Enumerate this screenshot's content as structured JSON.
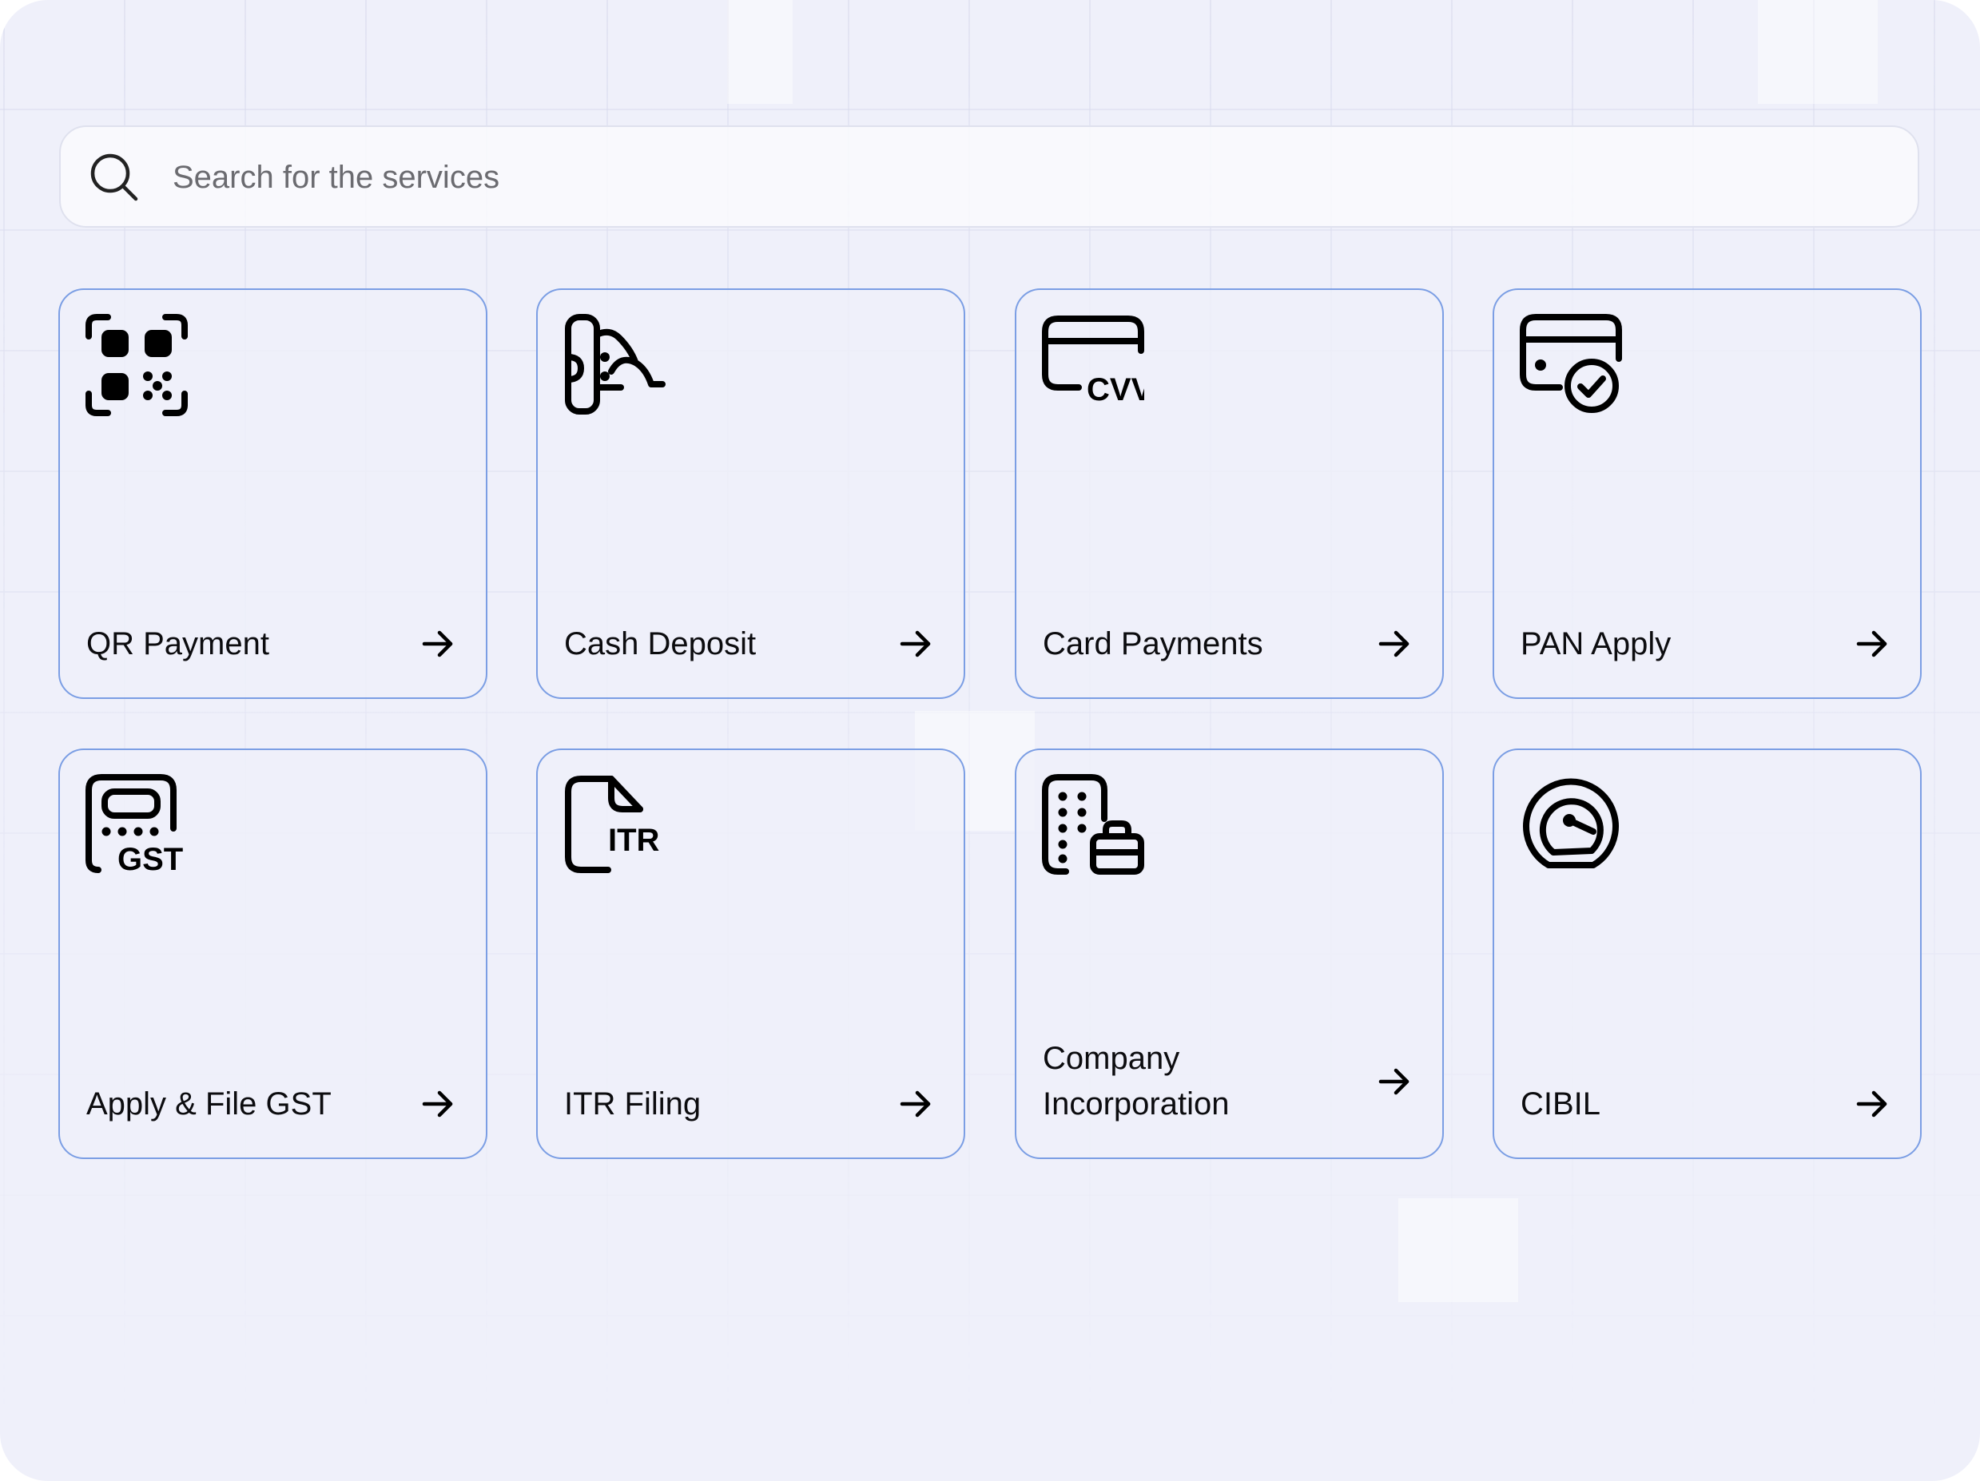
{
  "search": {
    "placeholder": "Search for the services",
    "value": ""
  },
  "services": [
    {
      "label": "QR Payment",
      "icon": "qr-code-icon"
    },
    {
      "label": "Cash Deposit",
      "icon": "cash-deposit-icon"
    },
    {
      "label": "Card Payments",
      "icon": "card-cvv-icon"
    },
    {
      "label": "PAN Apply",
      "icon": "pan-card-check-icon"
    },
    {
      "label": "Apply & File GST",
      "icon": "gst-receipt-icon"
    },
    {
      "label": "ITR Filing",
      "icon": "itr-document-icon"
    },
    {
      "label": "Company Incorporation",
      "icon": "company-building-icon"
    },
    {
      "label": "CIBIL",
      "icon": "credit-score-gauge-icon"
    }
  ],
  "colors": {
    "background": "#eff0fa",
    "card_border": "#7b9ee4",
    "text": "#0c0c0f"
  }
}
